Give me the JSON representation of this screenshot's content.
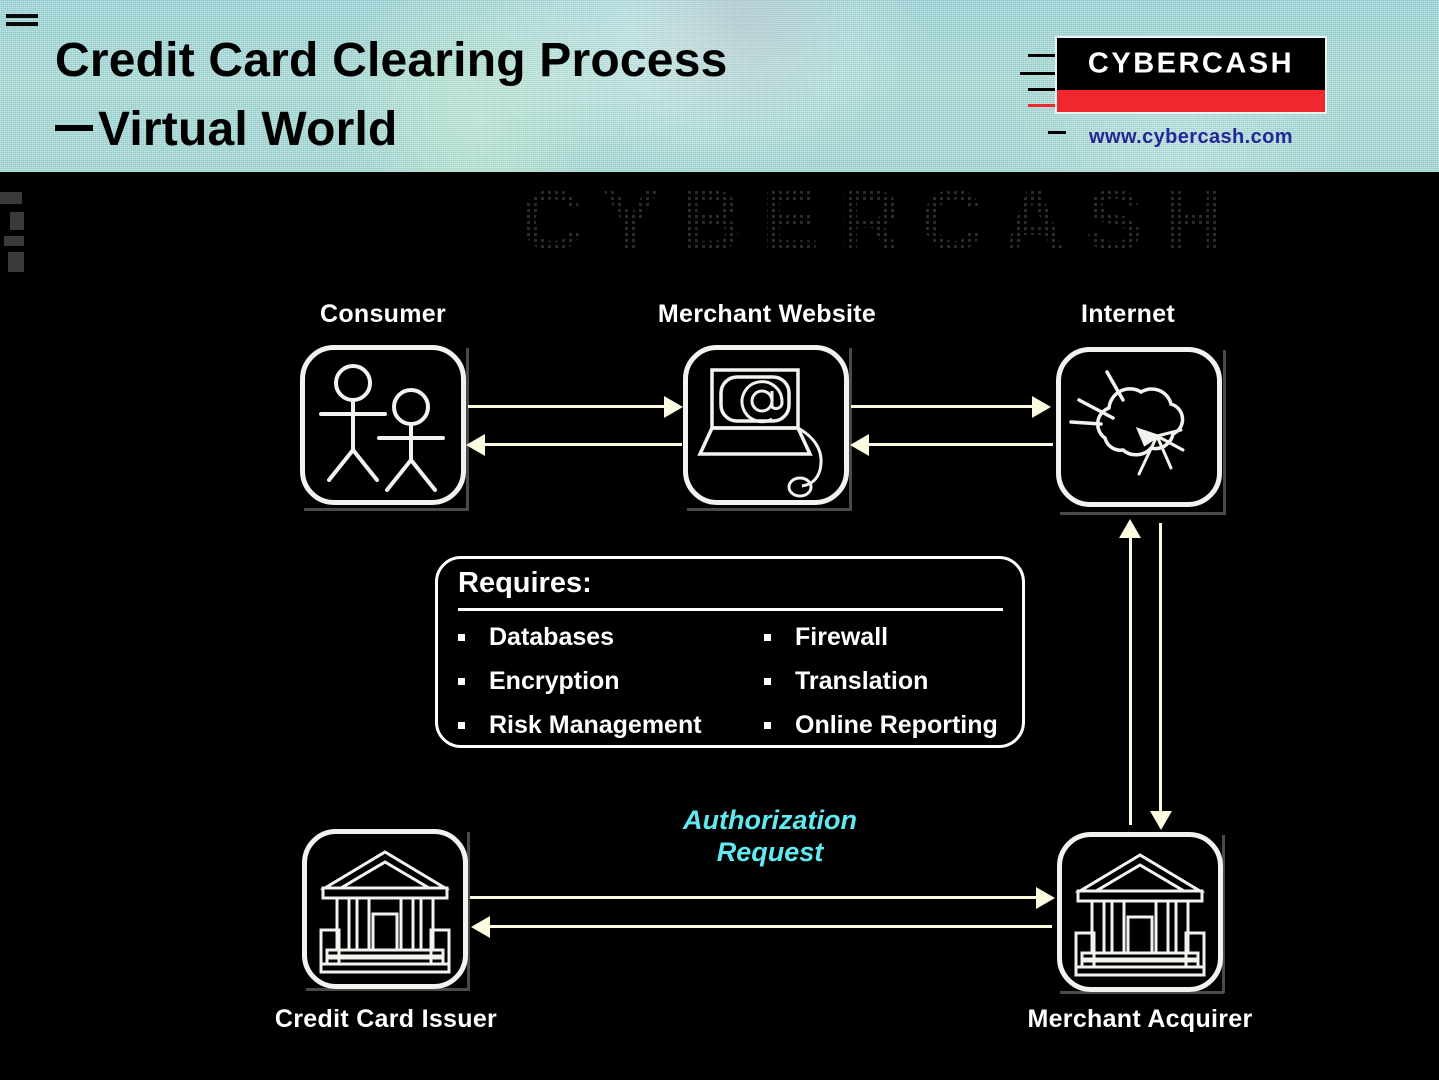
{
  "header": {
    "title_line1": "Credit Card Clearing Process",
    "title_line2": "Virtual World",
    "dash_prefix": "—",
    "logo": {
      "wordmark": "CYBERCASH",
      "url": "www.cybercash.com",
      "plate_bg": "#000000",
      "red_bar": "#f0282d",
      "url_color": "#25269a"
    },
    "bg_color": "#a8dcd9"
  },
  "watermark": {
    "text": "CYBERCASH",
    "color": "#2b2b2b"
  },
  "diagram": {
    "nodes": [
      {
        "id": "consumer",
        "label": "Consumer",
        "icon": "two-people-icon"
      },
      {
        "id": "merchant-website",
        "label": "Merchant Website",
        "icon": "computer-at-sign-icon"
      },
      {
        "id": "internet",
        "label": "Internet",
        "icon": "network-cloud-icon"
      },
      {
        "id": "credit-card-issuer",
        "label": "Credit Card Issuer",
        "icon": "bank-building-icon"
      },
      {
        "id": "merchant-acquirer",
        "label": "Merchant Acquirer",
        "icon": "bank-building-icon"
      }
    ],
    "annotation": {
      "line1": "Authorization",
      "line2": "Request",
      "color": "#62e8f0"
    },
    "arrow_color": "#fdfbdf",
    "flows": [
      {
        "from": "consumer",
        "to": "merchant-website",
        "direction": "right"
      },
      {
        "from": "merchant-website",
        "to": "consumer",
        "direction": "left"
      },
      {
        "from": "merchant-website",
        "to": "internet",
        "direction": "right"
      },
      {
        "from": "internet",
        "to": "merchant-website",
        "direction": "left"
      },
      {
        "from": "merchant-acquirer",
        "to": "internet",
        "direction": "up"
      },
      {
        "from": "internet",
        "to": "merchant-acquirer",
        "direction": "down"
      },
      {
        "from": "credit-card-issuer",
        "to": "merchant-acquirer",
        "direction": "right"
      },
      {
        "from": "merchant-acquirer",
        "to": "credit-card-issuer",
        "direction": "left"
      }
    ]
  },
  "requires": {
    "title": "Requires:",
    "rows": [
      {
        "left": "Databases",
        "right": "Firewall"
      },
      {
        "left": "Encryption",
        "right": "Translation"
      },
      {
        "left": "Risk Management",
        "right": "Online Reporting"
      }
    ]
  }
}
